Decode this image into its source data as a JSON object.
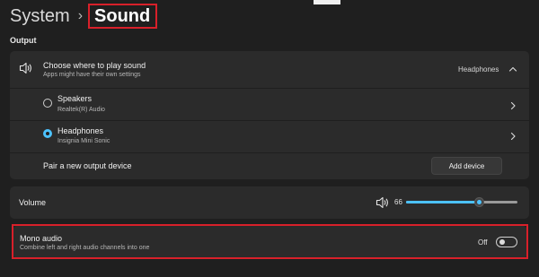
{
  "breadcrumb": {
    "root": "System",
    "separator": "›",
    "current": "Sound"
  },
  "output": {
    "section_title": "Output",
    "choose": {
      "title": "Choose where to play sound",
      "subtitle": "Apps might have their own settings",
      "selected_value": "Headphones",
      "icon": "speaker-icon",
      "expanded": true
    },
    "devices": [
      {
        "name": "Speakers",
        "detail": "Realtek(R) Audio",
        "selected": false
      },
      {
        "name": "Headphones",
        "detail": "Insignia Mini Sonic",
        "selected": true
      }
    ],
    "pair": {
      "label": "Pair a new output device",
      "button": "Add device"
    }
  },
  "volume": {
    "label": "Volume",
    "value": "66",
    "level_percent": 66,
    "icon": "speaker-icon"
  },
  "mono": {
    "title": "Mono audio",
    "subtitle": "Combine left and right audio channels into one",
    "state_label": "Off",
    "enabled": false
  },
  "colors": {
    "accent": "#4cc2ff",
    "highlight_border": "#d8202a",
    "card_bg": "#2b2b2b",
    "page_bg": "#1f1f1f"
  }
}
